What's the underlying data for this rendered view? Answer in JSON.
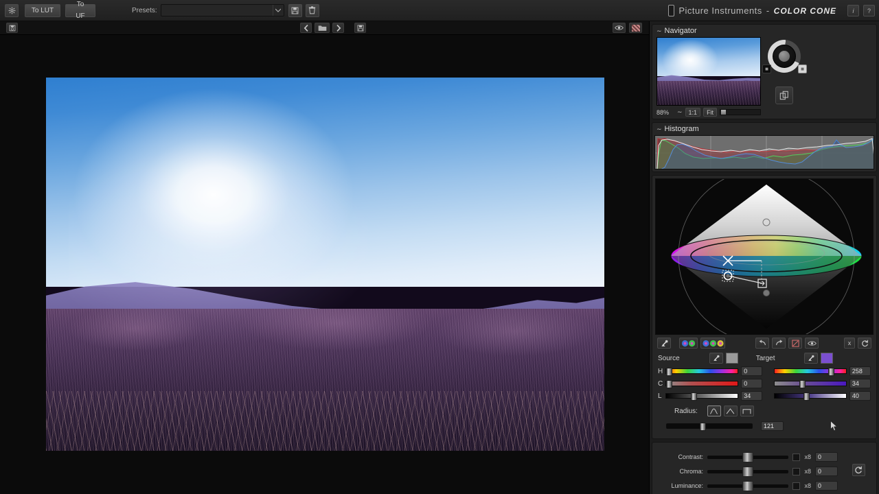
{
  "app": {
    "brand": "Picture Instruments",
    "separator": "-",
    "product": "COLOR CONE",
    "info_label": "i",
    "help_label": "?"
  },
  "toolbar": {
    "settings_icon": "gear-icon",
    "to_lut_label": "To LUT",
    "to_uf_label": "To UF",
    "presets_label": "Presets:",
    "presets_value": "",
    "presets_placeholder": "",
    "save_preset_icon": "floppy-disk-icon",
    "delete_preset_icon": "trash-icon"
  },
  "subbar": {
    "snapshot_icon": "snapshot-icon",
    "prev_icon": "chevron-left-icon",
    "folder_icon": "folder-icon",
    "next_icon": "chevron-right-icon",
    "save_icon": "floppy-disk-icon",
    "preview_icon": "eye-icon",
    "pattern_icon": "checker-pattern-icon"
  },
  "navigator": {
    "title": "Navigator",
    "zoom_percent": "88%",
    "fit_dropdown_icon": "chevron-down-icon",
    "one_to_one_label": "1:1",
    "fit_label": "Fit",
    "zoom_slider_value": 3,
    "copy_icon": "duplicate-icon"
  },
  "histogram": {
    "title": "Histogram",
    "channels": [
      "red",
      "green",
      "blue",
      "luminance"
    ]
  },
  "cone": {
    "name": "color-cone-3d-view"
  },
  "cone_tools": {
    "eyedropper_icon": "eyedropper-icon",
    "two_color_icon": "two-color-circles-icon",
    "three_color_icon": "three-color-circles-icon",
    "undo_icon": "undo-arrow-icon",
    "redo_icon": "redo-arrow-icon",
    "compare_icon": "compare-split-icon",
    "eye_icon": "eye-icon",
    "clear_label": "x",
    "reset_icon": "reset-circular-arrow-icon"
  },
  "source": {
    "label": "Source",
    "picker_icon": "eyedropper-icon",
    "swatch_color": "#9a9a9a",
    "channels": [
      {
        "key": "H",
        "value": "0",
        "knob_pct": 3
      },
      {
        "key": "C",
        "value": "0",
        "knob_pct": 3
      },
      {
        "key": "L",
        "value": "34",
        "knob_pct": 34
      }
    ]
  },
  "target": {
    "label": "Target",
    "picker_icon": "eyedropper-icon",
    "swatch_color": "#7b4fd0",
    "channels": [
      {
        "key": "H",
        "value": "258",
        "knob_pct": 72
      },
      {
        "key": "C",
        "value": "34",
        "knob_pct": 34
      },
      {
        "key": "L",
        "value": "40",
        "knob_pct": 40
      }
    ]
  },
  "radius": {
    "label": "Radius:",
    "shapes": [
      "bell-curve-icon",
      "triangle-curve-icon",
      "square-curve-icon"
    ],
    "selected_shape": 0,
    "value": "121",
    "knob_pct": 41
  },
  "adjustments": {
    "rows": [
      {
        "label": "Contrast:",
        "value": "0",
        "multiplier": "x8",
        "knob_pct": 50,
        "checked": false
      },
      {
        "label": "Chroma:",
        "value": "0",
        "multiplier": "x8",
        "knob_pct": 50,
        "checked": false
      },
      {
        "label": "Luminance:",
        "value": "0",
        "multiplier": "x8",
        "knob_pct": 50,
        "checked": false
      }
    ],
    "reset_icon": "reset-circular-arrow-icon"
  }
}
